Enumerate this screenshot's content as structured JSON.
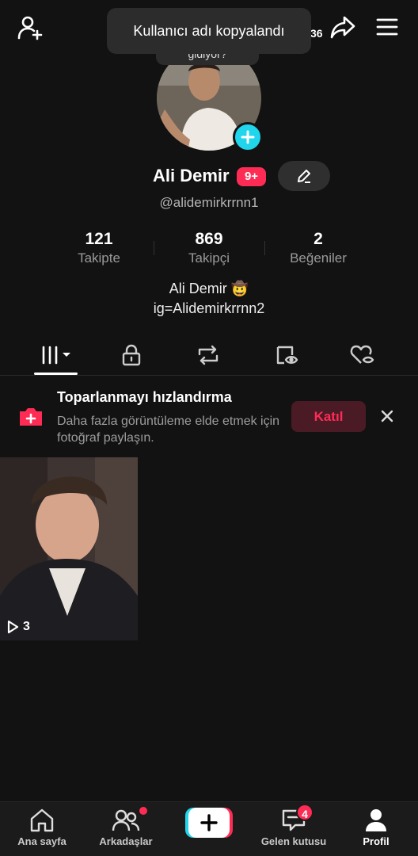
{
  "toast": {
    "message": "Kullanıcı adı kopyalandı",
    "peek_text": "gidiyor?"
  },
  "header": {
    "hidden_count": "36"
  },
  "profile": {
    "display_name": "Ali Demir",
    "badge": "9+",
    "username": "@alidemirkrrnn1",
    "bio_line1": "Ali Demir 🤠",
    "bio_line2": "ig=Alidemirkrrnn2"
  },
  "stats": [
    {
      "value": "121",
      "label": "Takipte"
    },
    {
      "value": "869",
      "label": "Takipçi"
    },
    {
      "value": "2",
      "label": "Beğeniler"
    }
  ],
  "banner": {
    "title": "Toparlanmayı hızlandırma",
    "description": "Daha fazla görüntüleme elde etmek için fotoğraf paylaşın.",
    "join_label": "Katıl"
  },
  "videos": [
    {
      "views": "3"
    }
  ],
  "bottom_nav": {
    "home": "Ana sayfa",
    "friends": "Arkadaşlar",
    "inbox": "Gelen kutusu",
    "inbox_badge": "4",
    "profile": "Profil"
  },
  "colors": {
    "accent": "#fe2c55",
    "cyan": "#20d5ec",
    "background": "#121212"
  },
  "icons": [
    "add-user-icon",
    "share-icon",
    "menu-icon",
    "plus-icon",
    "pencil-icon",
    "grid-icon",
    "lock-icon",
    "repost-icon",
    "tagged-icon",
    "liked-icon",
    "camera-plus-icon",
    "close-icon",
    "play-icon",
    "home-icon",
    "friends-icon",
    "create-icon",
    "inbox-icon",
    "profile-icon"
  ]
}
